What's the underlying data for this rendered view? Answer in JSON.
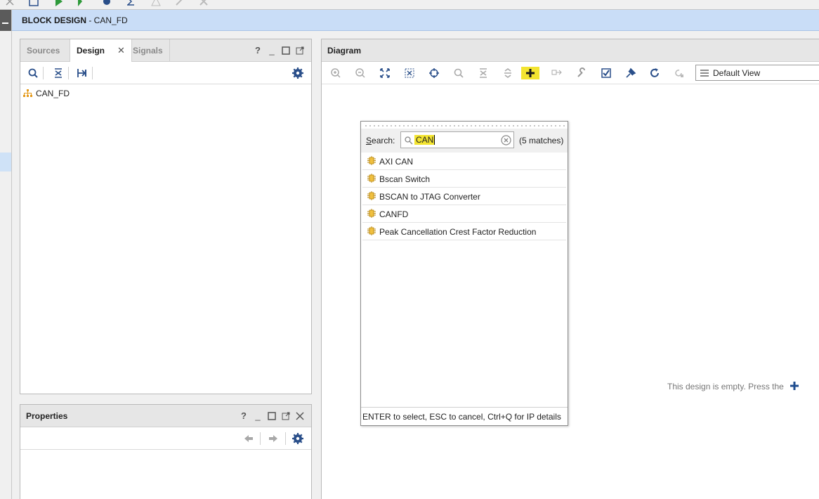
{
  "header": {
    "title_bold": "BLOCK DESIGN",
    "title_rest": " - CAN_FD"
  },
  "design_panel": {
    "tabs": [
      {
        "label": "Sources"
      },
      {
        "label": "Design"
      },
      {
        "label": "Signals"
      }
    ],
    "tree": [
      {
        "label": "CAN_FD"
      }
    ]
  },
  "properties_panel": {
    "title": "Properties"
  },
  "diagram_panel": {
    "title": "Diagram",
    "view_select": "Default View",
    "empty_message": "This design is empty. Press the"
  },
  "ip_popup": {
    "search_label_accel": "S",
    "search_label_rest": "earch:",
    "search_value": "CAN",
    "match_count": "(5 matches)",
    "results": [
      {
        "label": "AXI CAN"
      },
      {
        "label": "Bscan Switch"
      },
      {
        "label": "BSCAN to JTAG Converter"
      },
      {
        "label": "CANFD"
      },
      {
        "label": "Peak Cancellation Crest Factor Reduction"
      }
    ],
    "footer": "ENTER to select, ESC to cancel, Ctrl+Q for IP details"
  },
  "colors": {
    "header_bg": "#c9ddf7",
    "highlight": "#f3e430",
    "accent_blue": "#1f4d8f"
  }
}
